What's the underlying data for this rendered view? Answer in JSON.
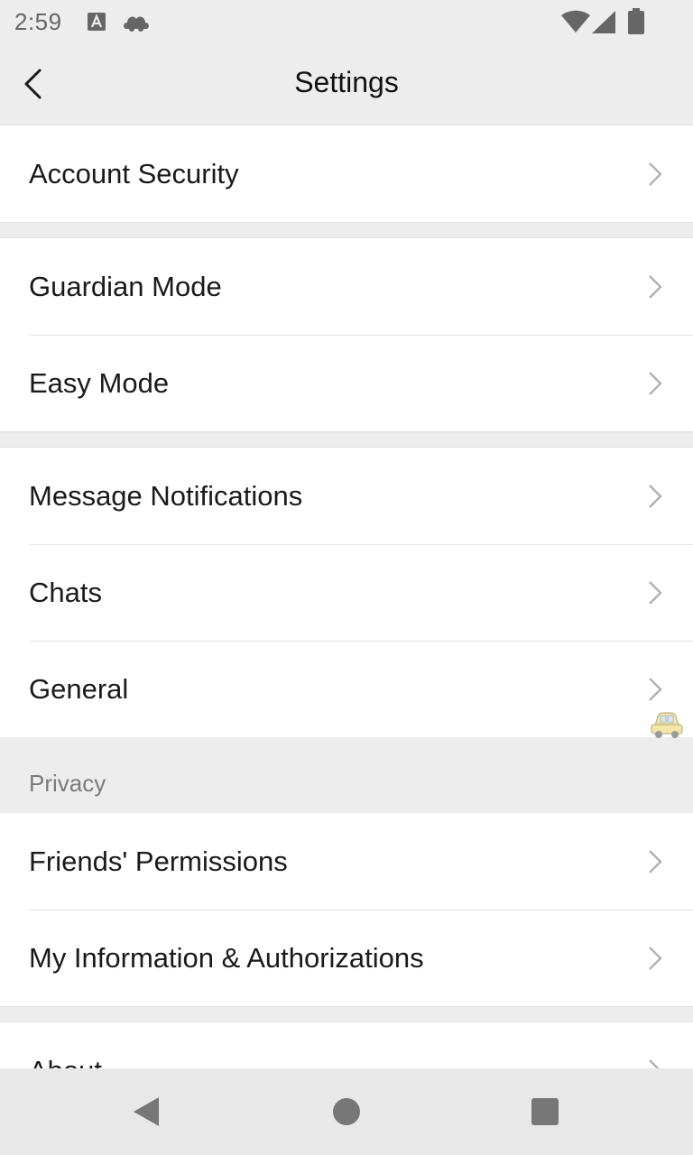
{
  "status_bar": {
    "time": "2:59",
    "icons": [
      "a-notification-icon",
      "cloud-icon",
      "wifi-icon",
      "signal-icon",
      "battery-icon"
    ]
  },
  "title_bar": {
    "title": "Settings",
    "back_icon": "back-arrow-icon"
  },
  "groups": [
    {
      "items": [
        {
          "label": "Account Security"
        }
      ]
    },
    {
      "items": [
        {
          "label": "Guardian Mode"
        },
        {
          "label": "Easy Mode"
        }
      ]
    },
    {
      "items": [
        {
          "label": "Message Notifications"
        },
        {
          "label": "Chats"
        },
        {
          "label": "General"
        }
      ]
    },
    {
      "header": "Privacy",
      "items": [
        {
          "label": "Friends' Permissions"
        },
        {
          "label": "My Information & Authorizations"
        }
      ]
    },
    {
      "items": [
        {
          "label": "About"
        }
      ]
    }
  ],
  "floating_icon": "car-icon",
  "nav_bar": {
    "icons": [
      "nav-back-icon",
      "nav-home-icon",
      "nav-recents-icon"
    ]
  },
  "colors": {
    "background": "#ededed",
    "row_background": "#ffffff",
    "text": "#1a1a1a",
    "secondary_text": "#7b7b7b",
    "chevron": "#b2b2b2"
  }
}
